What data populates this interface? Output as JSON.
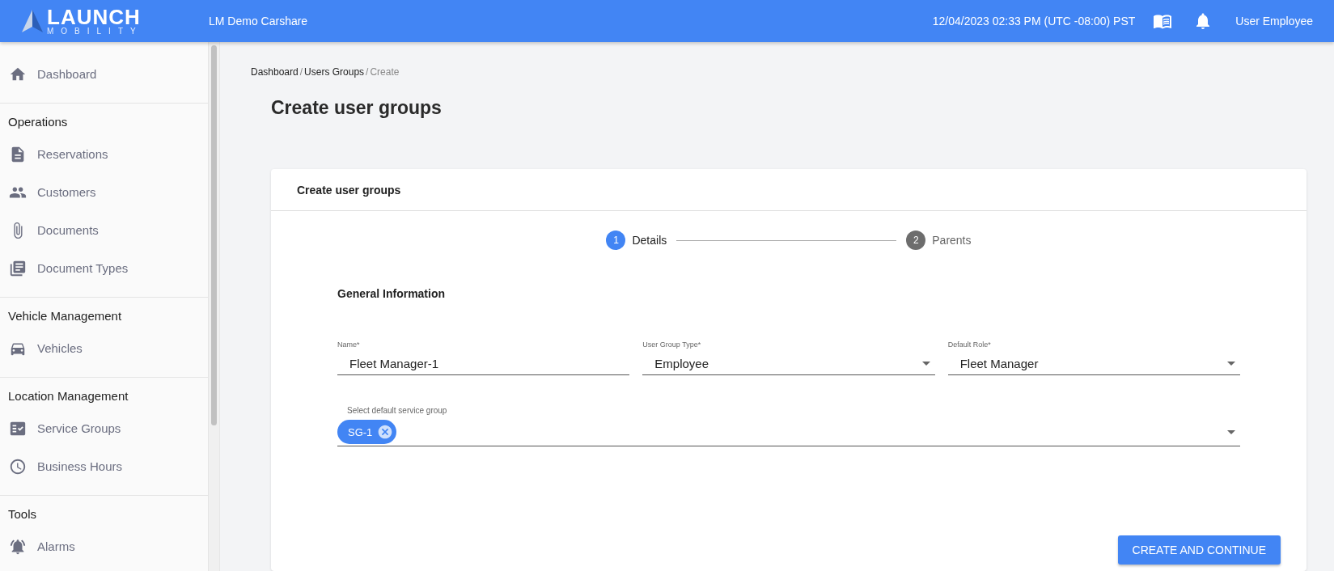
{
  "header": {
    "logo_top": "LAUNCH",
    "logo_bottom": "MOBILITY",
    "app_name": "LM Demo Carshare",
    "datetime": "12/04/2023 02:33 PM (UTC -08:00) PST",
    "user": "User Employee"
  },
  "sidebar": {
    "sections": [
      {
        "items": [
          {
            "label": "Dashboard",
            "kind": "home"
          }
        ]
      },
      {
        "title": "Operations",
        "items": [
          {
            "label": "Reservations",
            "kind": "file"
          },
          {
            "label": "Customers",
            "kind": "people"
          },
          {
            "label": "Documents",
            "kind": "clip"
          },
          {
            "label": "Document Types",
            "kind": "library"
          }
        ]
      },
      {
        "title": "Vehicle Management",
        "items": [
          {
            "label": "Vehicles",
            "kind": "car"
          }
        ]
      },
      {
        "title": "Location Management",
        "items": [
          {
            "label": "Service Groups",
            "kind": "checklist"
          },
          {
            "label": "Business Hours",
            "kind": "clock"
          }
        ]
      },
      {
        "title": "Tools",
        "items": [
          {
            "label": "Alarms",
            "kind": "alarm"
          }
        ]
      }
    ]
  },
  "breadcrumb": {
    "separator": "/",
    "items": [
      {
        "label": "Dashboard",
        "current": false
      },
      {
        "label": "Users Groups",
        "current": false
      },
      {
        "label": "Create",
        "current": true
      }
    ]
  },
  "page_title": "Create user groups",
  "card": {
    "title": "Create user groups",
    "steps": [
      {
        "number": "1",
        "label": "Details",
        "selected": true
      },
      {
        "number": "2",
        "label": "Parents",
        "selected": false
      }
    ],
    "section_title": "General Information",
    "fields": [
      {
        "label": "Name*",
        "value": "Fleet Manager-1",
        "kind": "text"
      },
      {
        "label": "User Group Type*",
        "value": "Employee",
        "kind": "select"
      },
      {
        "label": "Default Role*",
        "value": "Fleet Manager",
        "kind": "select"
      }
    ],
    "service_group": {
      "label": "Select default service group",
      "chips": [
        "SG-1"
      ]
    },
    "submit": "CREATE AND CONTINUE"
  }
}
